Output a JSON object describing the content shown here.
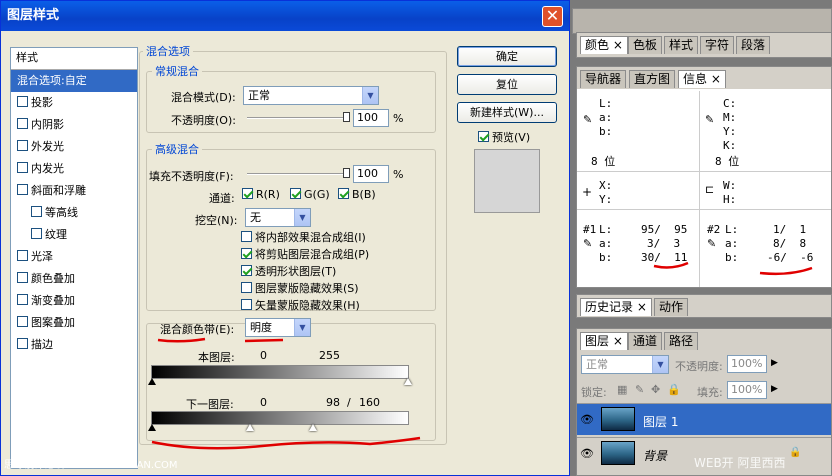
{
  "dialog": {
    "title": "图层样式",
    "close_glyph": "✕"
  },
  "styles": {
    "header": "样式",
    "items": [
      {
        "label": "混合选项:自定",
        "selected": true,
        "checkbox": false,
        "indent": false
      },
      {
        "label": "投影",
        "checkbox": true,
        "indent": false
      },
      {
        "label": "内阴影",
        "checkbox": true,
        "indent": false
      },
      {
        "label": "外发光",
        "checkbox": true,
        "indent": false
      },
      {
        "label": "内发光",
        "checkbox": true,
        "indent": false
      },
      {
        "label": "斜面和浮雕",
        "checkbox": true,
        "indent": false
      },
      {
        "label": "等高线",
        "checkbox": true,
        "indent": true
      },
      {
        "label": "纹理",
        "checkbox": true,
        "indent": true
      },
      {
        "label": "光泽",
        "checkbox": true,
        "indent": false
      },
      {
        "label": "颜色叠加",
        "checkbox": true,
        "indent": false
      },
      {
        "label": "渐变叠加",
        "checkbox": true,
        "indent": false
      },
      {
        "label": "图案叠加",
        "checkbox": true,
        "indent": false
      },
      {
        "label": "描边",
        "checkbox": true,
        "indent": false
      }
    ]
  },
  "blend": {
    "group_title": "混合选项",
    "general": {
      "title": "常规混合",
      "mode_label": "混合模式(D):",
      "mode_value": "正常",
      "opacity_label": "不透明度(O):",
      "opacity_value": "100",
      "opacity_unit": "%",
      "opacity_fraction": 1.0
    },
    "advanced": {
      "title": "高级混合",
      "fill_label": "填充不透明度(F):",
      "fill_value": "100",
      "fill_unit": "%",
      "fill_fraction": 1.0,
      "channels_label": "通道:",
      "ch_r": "R(R)",
      "ch_g": "G(G)",
      "ch_b": "B(B)",
      "knockout_label": "挖空(N):",
      "knockout_value": "无",
      "options": [
        {
          "label": "将内部效果混合成组(I)",
          "checked": false
        },
        {
          "label": "将剪贴图层混合成组(P)",
          "checked": true
        },
        {
          "label": "透明形状图层(T)",
          "checked": true
        },
        {
          "label": "图层蒙版隐藏效果(S)",
          "checked": false
        },
        {
          "label": "矢量蒙版隐藏效果(H)",
          "checked": false
        }
      ]
    },
    "blendif": {
      "label": "混合颜色带(E):",
      "value": "明度",
      "this_layer_label": "本图层:",
      "this_low": "0",
      "this_high": "255",
      "under_label": "下一图层:",
      "under_low": "0",
      "under_mid": "98",
      "under_sep": "/",
      "under_high": "160",
      "under_mid_value": 98,
      "under_high_value": 160
    }
  },
  "buttons": {
    "ok": "确定",
    "reset": "复位",
    "new_style": "新建样式(W)...",
    "preview_label": "预览(V)",
    "preview_checked": true
  },
  "panels": {
    "swatches_tabs": [
      "颜色",
      "色板",
      "样式",
      "字符",
      "段落"
    ],
    "info_tabs": [
      "导航器",
      "直方图",
      "信息"
    ],
    "info": {
      "lab_l": "L:",
      "lab_a": "a:",
      "lab_b": "b:",
      "cmyk_c": "C:",
      "cmyk_m": "M:",
      "cmyk_y": "Y:",
      "cmyk_k": "K:",
      "bits_left": "8 位",
      "bits_right": "8 位",
      "pos_x": "X:",
      "pos_y": "Y:",
      "size_w": "W:",
      "size_h": "H:",
      "s1": {
        "id": "#1",
        "l": "95/  95",
        "a": "3/  3",
        "b": "30/  11"
      },
      "s2": {
        "id": "#2",
        "l": "1/  1",
        "a": "8/  8",
        "b": "-6/  -6"
      }
    },
    "history_tabs": [
      "历史记录",
      "动作"
    ],
    "layers_tabs": [
      "图层",
      "通道",
      "路径"
    ],
    "layers": {
      "mode": "正常",
      "opacity_label": "不透明度:",
      "opacity_value": "100%",
      "lock_label": "锁定:",
      "fill_label": "填充:",
      "fill_value": "100%",
      "items": [
        {
          "name": "图层 1",
          "selected": true
        },
        {
          "name": "背景",
          "selected": false
        }
      ]
    }
  },
  "watermark": {
    "left": "思缘设计论坛  WWW.MISSYUAN.COM",
    "right": "WEB开 阿里西西"
  },
  "colors": {
    "title_bar": "#0a5fe8",
    "selection": "#316ac5",
    "annotation": "#e00000"
  }
}
